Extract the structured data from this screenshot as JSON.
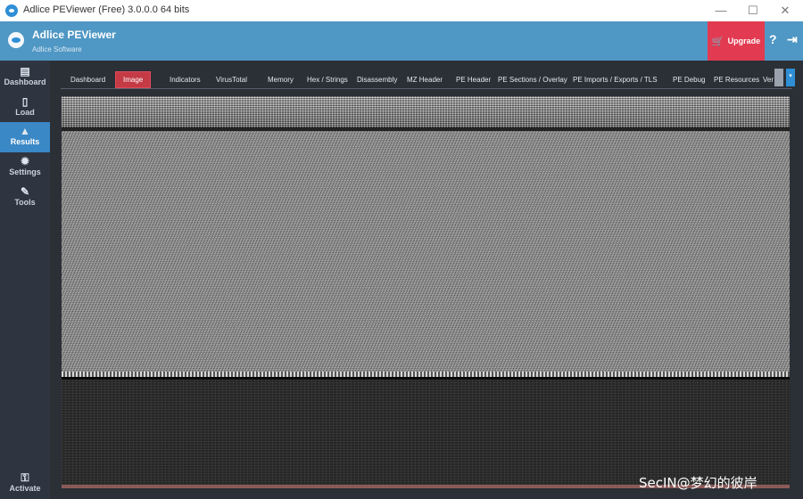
{
  "window": {
    "title": "Adlice PEViewer (Free) 3.0.0.0 64 bits",
    "min": "—",
    "max": "☐",
    "close": "✕"
  },
  "header": {
    "app_name": "Adlice PEViewer",
    "company": "Adlice Software",
    "upgrade_label": "Upgrade",
    "help": "?",
    "logout": "⇥"
  },
  "sidebar": {
    "items": [
      {
        "label": "Dashboard",
        "icon": "chart-icon"
      },
      {
        "label": "Load",
        "icon": "file-icon"
      },
      {
        "label": "Results",
        "icon": "flask-icon"
      },
      {
        "label": "Settings",
        "icon": "gear-icon"
      },
      {
        "label": "Tools",
        "icon": "wrench-icon"
      }
    ],
    "activate_label": "Activate"
  },
  "tabs": [
    "Dashboard",
    "Image",
    "Indicators",
    "VirusTotal",
    "Memory",
    "Hex / Strings",
    "Disassembly",
    "MZ Header",
    "PE Header",
    "PE Sections / Overlay",
    "PE Imports / Exports / TLS",
    "PE Debug",
    "PE Resources",
    "Ver"
  ],
  "active_tab": "Image",
  "watermark": "SecIN@梦幻的彼岸"
}
